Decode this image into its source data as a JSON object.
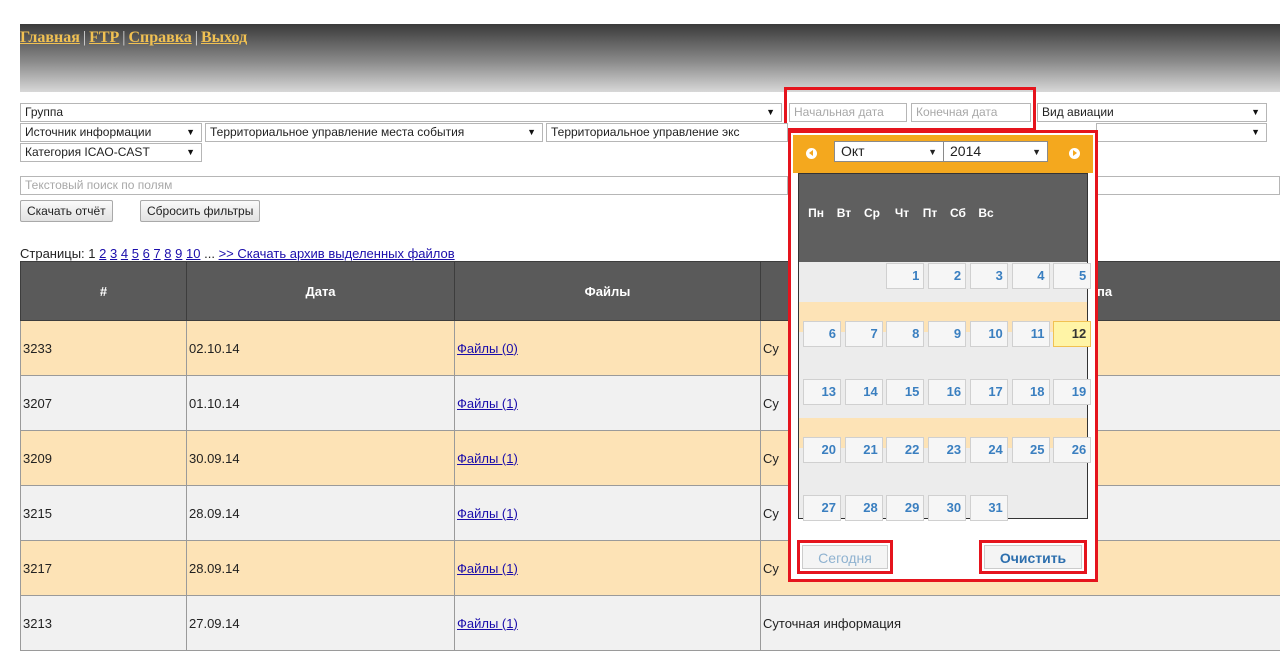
{
  "nav": {
    "items": [
      "Главная",
      "FTP",
      "Справка",
      "Выход"
    ]
  },
  "filters": {
    "group": "Группа",
    "start_date_placeholder": "Начальная дата",
    "end_date_placeholder": "Конечная дата",
    "aviation_type": "Вид авиации",
    "info_source": "Источник информации",
    "territorial_event": "Территориальное управление места события",
    "territorial_exploit": "Территориальное управление экс",
    "icao_category": "Категория ICAO-CAST",
    "text_search_placeholder": "Текстовый поиск по полям",
    "download_report": "Скачать отчёт",
    "reset_filters": "Сбросить фильтры"
  },
  "pagination": {
    "label": "Страницы: 1",
    "pages": [
      "2",
      "3",
      "4",
      "5",
      "6",
      "7",
      "8",
      "9",
      "10"
    ],
    "ellipsis": "...",
    "download_archive": ">> Скачать архив выделенных файлов"
  },
  "table": {
    "headers": [
      "#",
      "Дата",
      "Файлы",
      "па"
    ],
    "rows": [
      {
        "id": "3233",
        "date": "02.10.14",
        "files": "Файлы (0)",
        "type": "Су"
      },
      {
        "id": "3207",
        "date": "01.10.14",
        "files": "Файлы (1)",
        "type": "Су"
      },
      {
        "id": "3209",
        "date": "30.09.14",
        "files": "Файлы (1)",
        "type": "Су"
      },
      {
        "id": "3215",
        "date": "28.09.14",
        "files": "Файлы (1)",
        "type": "Су"
      },
      {
        "id": "3217",
        "date": "28.09.14",
        "files": "Файлы (1)",
        "type": "Су"
      },
      {
        "id": "3213",
        "date": "27.09.14",
        "files": "Файлы (1)",
        "type": "Суточная информация"
      }
    ]
  },
  "calendar": {
    "month": "Окт",
    "year": "2014",
    "weekdays": [
      "Пн",
      "Вт",
      "Ср",
      "Чт",
      "Пт",
      "Сб",
      "Вс"
    ],
    "weeks": [
      [
        "",
        "",
        "1",
        "2",
        "3",
        "4",
        "5"
      ],
      [
        "6",
        "7",
        "8",
        "9",
        "10",
        "11",
        "12"
      ],
      [
        "13",
        "14",
        "15",
        "16",
        "17",
        "18",
        "19"
      ],
      [
        "20",
        "21",
        "22",
        "23",
        "24",
        "25",
        "26"
      ],
      [
        "27",
        "28",
        "29",
        "30",
        "31",
        "",
        ""
      ]
    ],
    "today": "12",
    "today_button": "Сегодня",
    "clear_button": "Очистить"
  },
  "colors": {
    "accent": "#f4a81e",
    "highlight": "#e5141d",
    "row_alt": "#fde3b6",
    "header_bg": "#5a5a5a"
  }
}
